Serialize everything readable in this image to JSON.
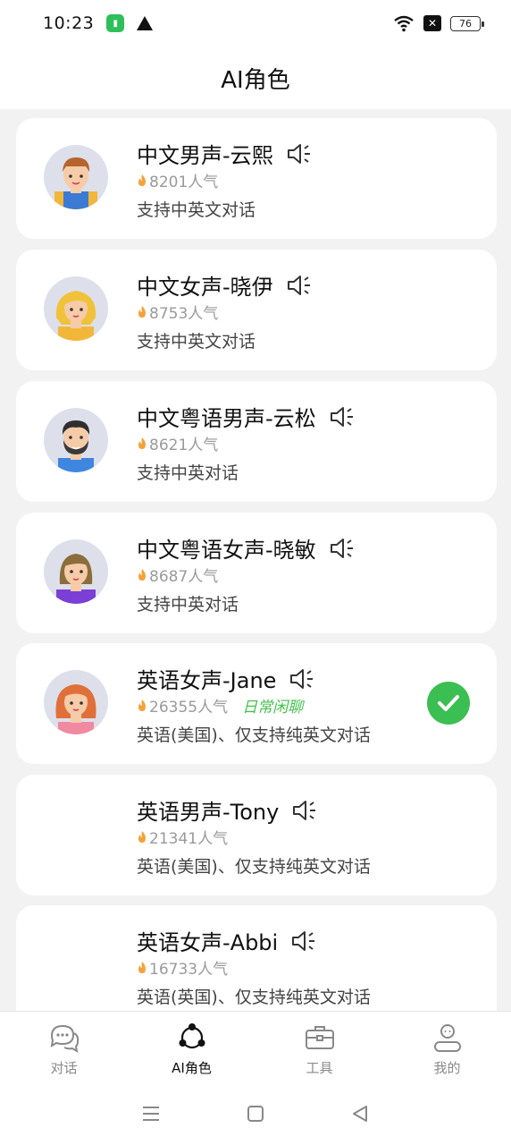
{
  "status": {
    "time": "10:23",
    "battery": "76"
  },
  "header": {
    "title": "AI角色"
  },
  "roles": [
    {
      "name": "中文男声-云熙",
      "popularity": "8201人气",
      "desc": "支持中英文对话",
      "avatar": "boy-yellow-overalls",
      "selected": false
    },
    {
      "name": "中文女声-晓伊",
      "popularity": "8753人气",
      "desc": "支持中英文对话",
      "avatar": "girl-blonde",
      "selected": false
    },
    {
      "name": "中文粤语男声-云松",
      "popularity": "8621人气",
      "desc": "支持中英对话",
      "avatar": "man-beard",
      "selected": false
    },
    {
      "name": "中文粤语女声-晓敏",
      "popularity": "8687人气",
      "desc": "支持中英对话",
      "avatar": "woman-brown-hair",
      "selected": false
    },
    {
      "name": "英语女声-Jane",
      "popularity": "26355人气",
      "tag": "日常闲聊",
      "desc": "英语(美国)、仅支持纯英文对话",
      "avatar": "woman-red-hair",
      "selected": true
    },
    {
      "name": "英语男声-Tony",
      "popularity": "21341人气",
      "desc": "英语(美国)、仅支持纯英文对话",
      "avatar": "",
      "selected": false
    },
    {
      "name": "英语女声-Abbi",
      "popularity": "16733人气",
      "desc": "英语(英国)、仅支持纯英文对话",
      "avatar": "",
      "selected": false
    }
  ],
  "tabs": [
    {
      "label": "对话",
      "icon": "chat-icon",
      "active": false
    },
    {
      "label": "AI角色",
      "icon": "ai-role-icon",
      "active": true
    },
    {
      "label": "工具",
      "icon": "toolbox-icon",
      "active": false
    },
    {
      "label": "我的",
      "icon": "profile-icon",
      "active": false
    }
  ],
  "colors": {
    "accent_green": "#3bbe52",
    "tag_green": "#43c24c",
    "flame": "#f5a13a"
  }
}
